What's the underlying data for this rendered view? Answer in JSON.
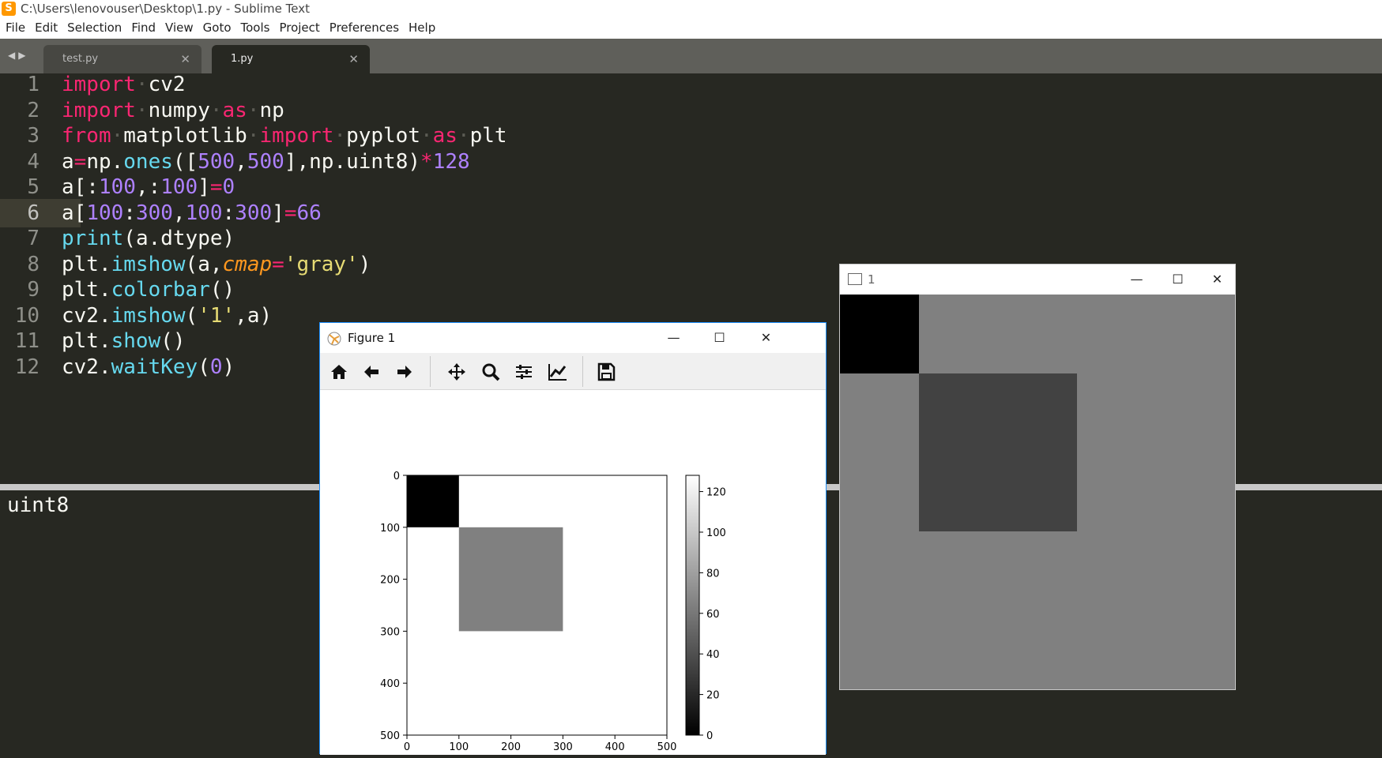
{
  "window": {
    "title": "C:\\Users\\lenovouser\\Desktop\\1.py - Sublime Text"
  },
  "menu": [
    "File",
    "Edit",
    "Selection",
    "Find",
    "View",
    "Goto",
    "Tools",
    "Project",
    "Preferences",
    "Help"
  ],
  "tabs": [
    {
      "label": "test.py",
      "active": false
    },
    {
      "label": "1.py",
      "active": true
    }
  ],
  "code_lines": [
    "import cv2",
    "import numpy as np",
    "from matplotlib import pyplot as plt",
    "a=np.ones([500,500],np.uint8)*128",
    "a[:100,:100]=0",
    "a[100:300,100:300]=66",
    "print(a.dtype)",
    "plt.imshow(a,cmap='gray')",
    "plt.colorbar()",
    "cv2.imshow('1',a)",
    "plt.show()",
    "cv2.waitKey(0)"
  ],
  "current_line": 6,
  "console": {
    "output": "uint8"
  },
  "figure_window": {
    "title": "Figure 1",
    "toolbar": [
      "home-icon",
      "back-icon",
      "forward-icon",
      "pan-icon",
      "zoom-icon",
      "configure-subplots-icon",
      "edit-axis-icon",
      "save-icon"
    ]
  },
  "cv_window": {
    "title": "1",
    "image": {
      "size": [
        500,
        500
      ],
      "background": 128,
      "regions": [
        {
          "rows": [
            0,
            100
          ],
          "cols": [
            0,
            100
          ],
          "value": 0
        },
        {
          "rows": [
            100,
            300
          ],
          "cols": [
            100,
            300
          ],
          "value": 66
        }
      ]
    }
  },
  "chart_data": {
    "type": "heatmap",
    "title": "",
    "x_ticks": [
      "0",
      "100",
      "200",
      "300",
      "400",
      "500"
    ],
    "y_ticks": [
      "0",
      "100",
      "200",
      "300",
      "400",
      "500"
    ],
    "xlim": [
      0,
      500
    ],
    "ylim": [
      500,
      0
    ],
    "colormap": "gray",
    "colorbar": {
      "ticks": [
        "0",
        "20",
        "40",
        "60",
        "80",
        "100",
        "120"
      ],
      "range": [
        0,
        128
      ]
    },
    "image": {
      "size": [
        500,
        500
      ],
      "background": 128,
      "regions": [
        {
          "rows": [
            0,
            100
          ],
          "cols": [
            0,
            100
          ],
          "value": 0
        },
        {
          "rows": [
            100,
            300
          ],
          "cols": [
            100,
            300
          ],
          "value": 66
        }
      ]
    }
  }
}
